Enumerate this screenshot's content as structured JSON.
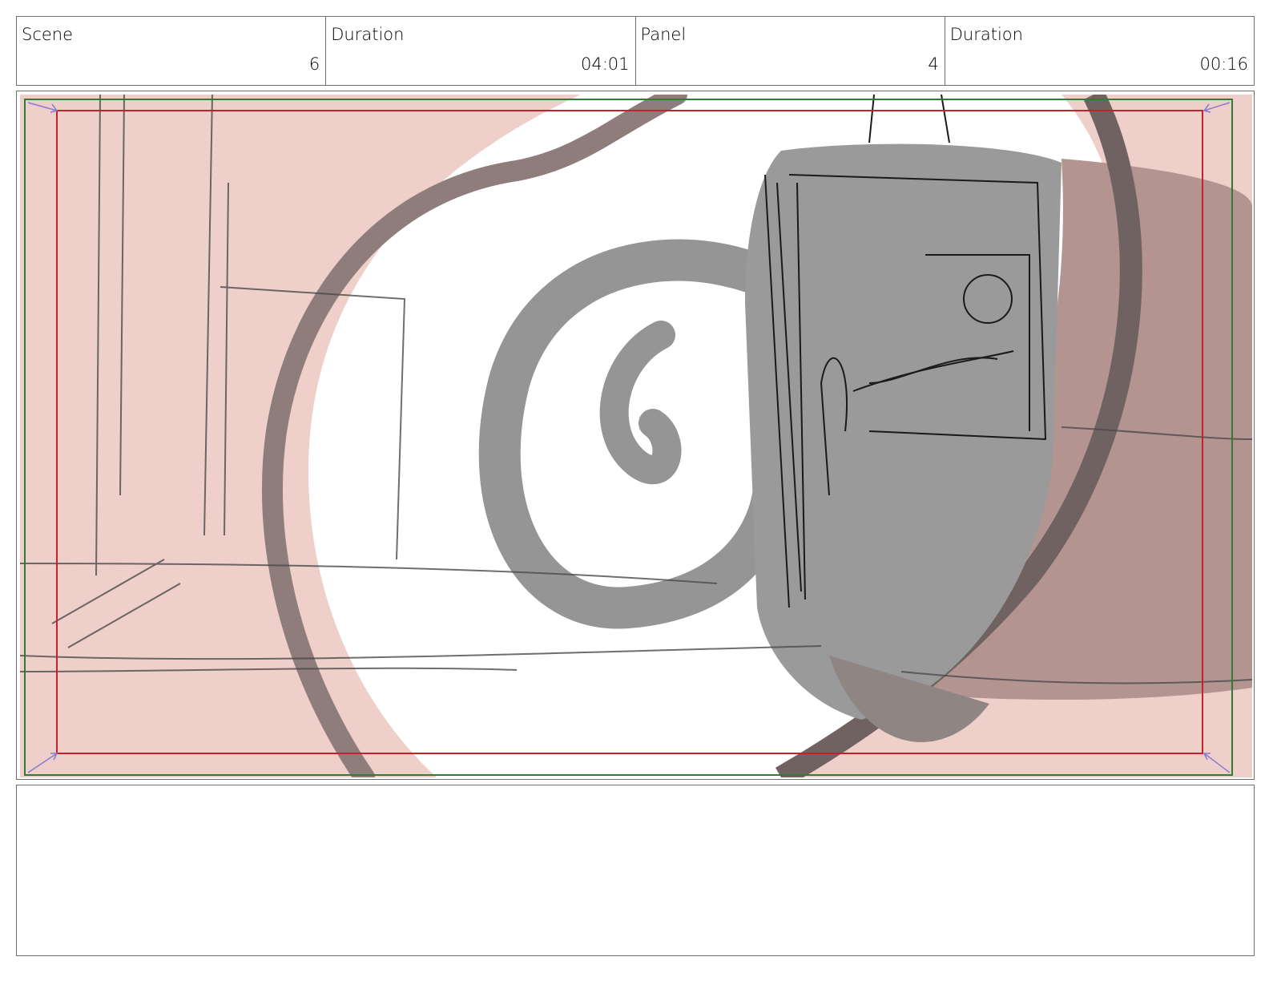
{
  "header": {
    "scene_label": "Scene",
    "scene_value": "6",
    "scene_duration_label": "Duration",
    "scene_duration_value": "04:01",
    "panel_label": "Panel",
    "panel_value": "4",
    "panel_duration_label": "Duration",
    "panel_duration_value": "00:16"
  },
  "colors": {
    "safe_area_red": "#c8202a",
    "action_safe_green": "#2e7d32",
    "corner_arrow_purple": "#8a7ad0",
    "vignette_pink": "#e9b3ab",
    "sketch_gray": "#8c8c8c"
  },
  "notes": {
    "text": ""
  }
}
